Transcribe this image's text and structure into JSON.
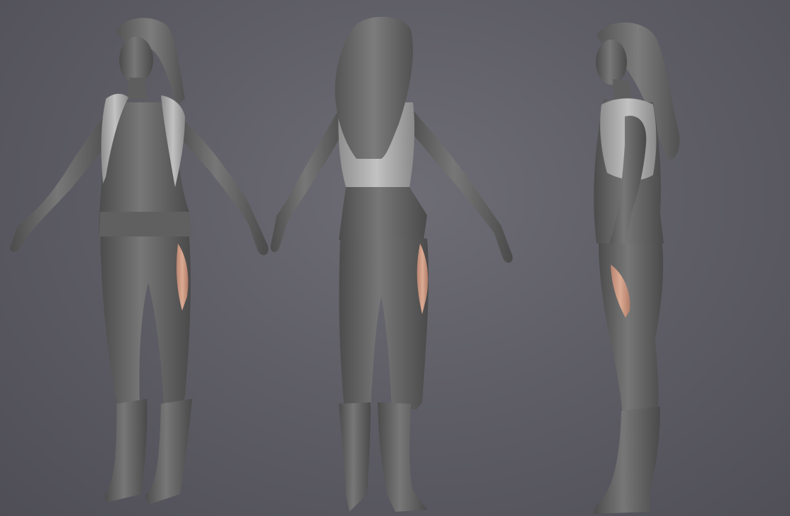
{
  "scene": {
    "background": "#5f5e66",
    "sculpt_color": "#6a6a6a",
    "sculpt_shade": "#4a4a4a",
    "sculpt_highlight": "#8c8c8c",
    "skin_color": "#d4a08a",
    "vest_color": "#b8b8b8"
  },
  "figures": [
    {
      "view": "front"
    },
    {
      "view": "back"
    },
    {
      "view": "side"
    }
  ]
}
